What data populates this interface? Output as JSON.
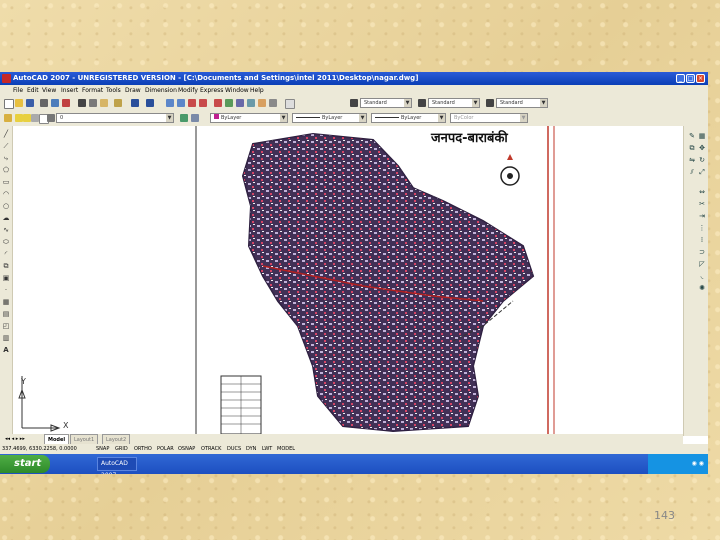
{
  "window": {
    "title": "AutoCAD 2007 - UNREGISTERED VERSION - [C:\\Documents and Settings\\intel 2011\\Desktop\\nagar.dwg]",
    "controls": [
      "_",
      "□",
      "×"
    ]
  },
  "menu": [
    "File",
    "Edit",
    "View",
    "Insert",
    "Format",
    "Tools",
    "Draw",
    "Dimension",
    "Modify",
    "Express",
    "Window",
    "Help"
  ],
  "toolbar": {
    "text_style": "Standard",
    "dim_style": "Standard",
    "table_style": "Standard",
    "layer": "0",
    "color": "ByLayer",
    "linetype": "ByLayer",
    "lineweight": "ByLayer",
    "plot_style": "ByColor"
  },
  "map": {
    "title": "जनपद-बाराबंकी"
  },
  "tabs": [
    "Model",
    "Layout1",
    "Layout2"
  ],
  "status": {
    "coords": "337.4699, 6330.2258, 0.0000",
    "toggles": [
      "SNAP",
      "GRID",
      "ORTHO",
      "POLAR",
      "OSNAP",
      "OTRACK",
      "DUCS",
      "DYN",
      "LWT",
      "MODEL"
    ]
  },
  "taskbar": {
    "start_label": "start",
    "task_item": "AutoCAD 2007 - [UNR..."
  },
  "slide": {
    "page_number": "143"
  },
  "colors": {
    "title_bar": "#0a3fb6",
    "map_fill": "#7b6a8f",
    "border_red": "#c0392b"
  }
}
